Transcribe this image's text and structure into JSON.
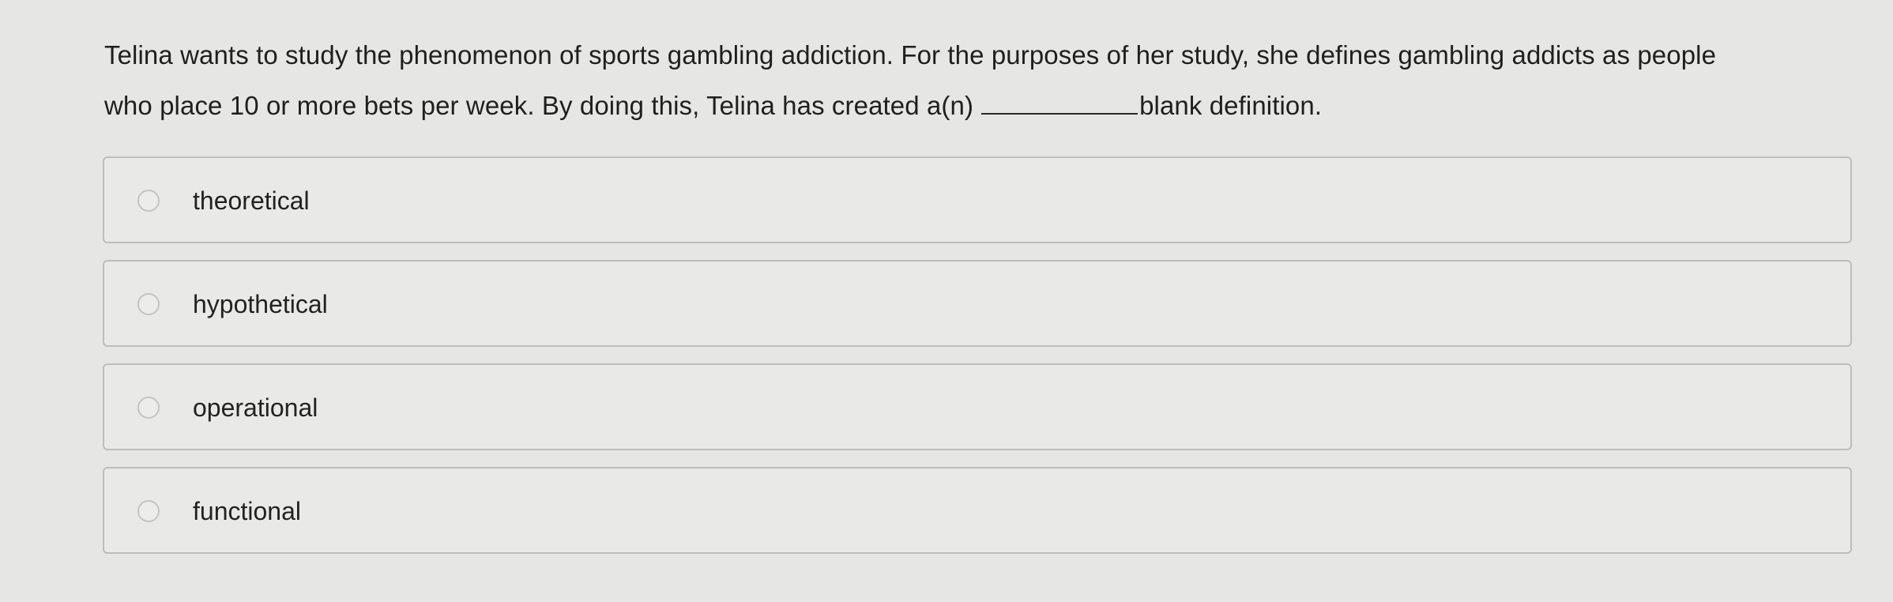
{
  "question": {
    "line1": "Telina wants to study the phenomenon of sports gambling addiction. For the purposes of her study, she defines gambling addicts as people",
    "line2_before_blank": "who place 10 or more bets per week. By doing this, Telina has created a(n)",
    "line2_after_blank": "blank definition."
  },
  "options": [
    {
      "label": "theoretical"
    },
    {
      "label": "hypothetical"
    },
    {
      "label": "operational"
    },
    {
      "label": "functional"
    }
  ]
}
